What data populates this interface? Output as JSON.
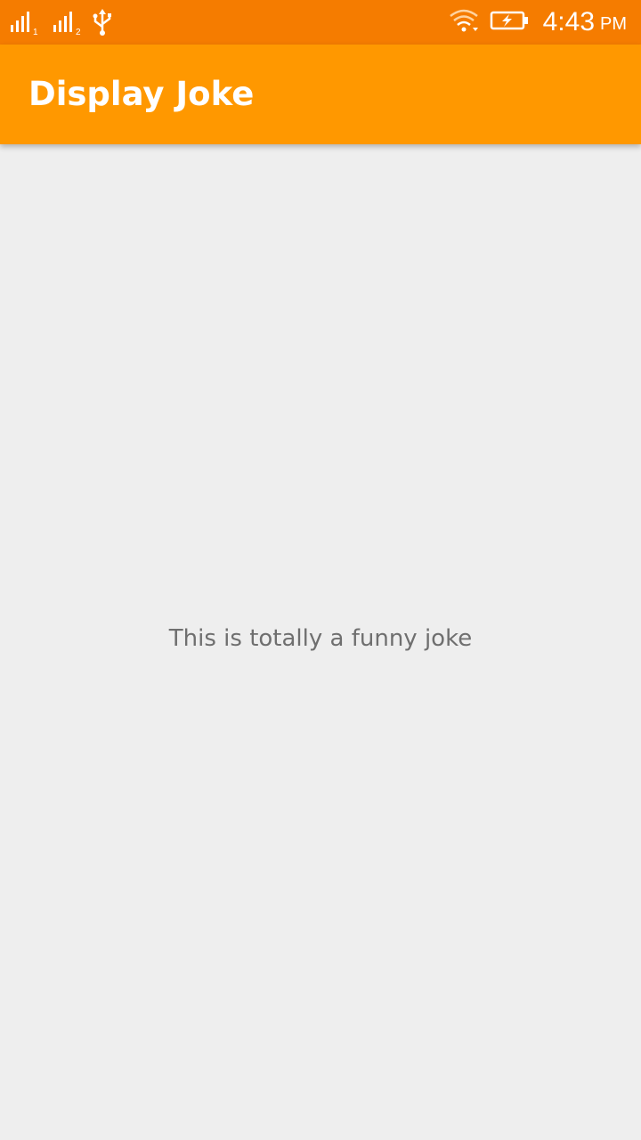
{
  "status_bar": {
    "sim1_label": "1",
    "sim2_label": "2",
    "icons": [
      "signal-sim1-icon",
      "signal-sim2-icon",
      "usb-icon",
      "wifi-icon",
      "battery-charging-icon"
    ],
    "time": "4:43",
    "ampm": "PM",
    "background_color": "#f57c00"
  },
  "app_bar": {
    "title": "Display Joke",
    "background_color": "#ff9800"
  },
  "content": {
    "joke_text": "This is totally a funny joke",
    "background_color": "#eeeeee",
    "text_color": "#6f6f6f"
  }
}
